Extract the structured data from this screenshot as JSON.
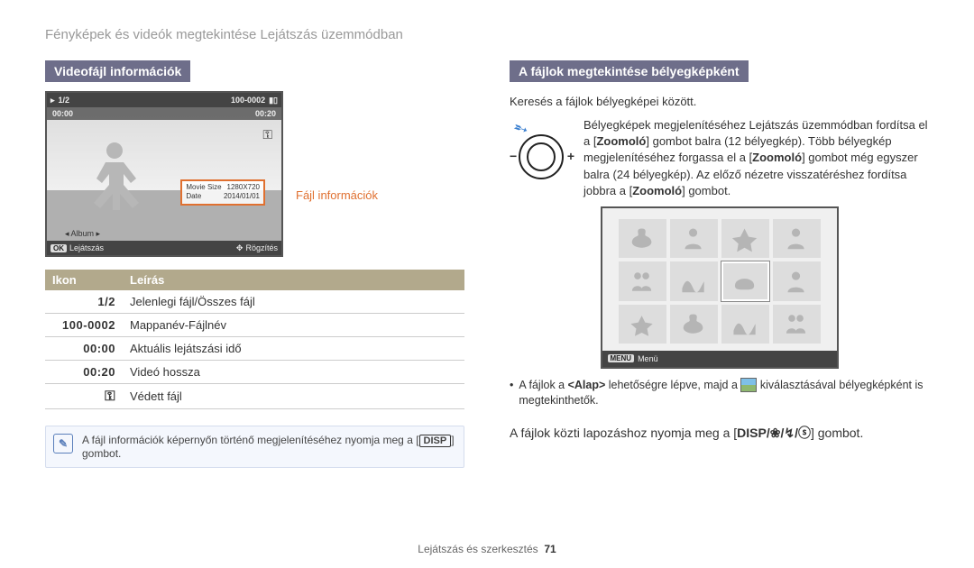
{
  "page_title": "Fényképek és videók megtekintése Lejátszás üzemmódban",
  "footer": {
    "section": "Lejátszás és szerkesztés",
    "page": "71"
  },
  "left": {
    "header": "Videofájl információk",
    "callout": "Fájl információk",
    "shot": {
      "topbar": {
        "counter": "1/2",
        "folder": "100-0002"
      },
      "times": {
        "current": "00:00",
        "total": "00:20"
      },
      "infobox": {
        "row1_label": "Movie Size",
        "row1_val": "1280X720",
        "row2_label": "Date",
        "row2_val": "2014/01/01"
      },
      "album_label": "Album",
      "botbar": {
        "ok": "OK",
        "play": "Lejátszás",
        "rec": "Rögzítés"
      }
    },
    "table": {
      "col1": "Ikon",
      "col2": "Leírás",
      "rows": [
        {
          "icon": "1/2",
          "desc": "Jelenlegi fájl/Összes fájl"
        },
        {
          "icon": "100-0002",
          "desc": "Mappanév-Fájlnév"
        },
        {
          "icon": "00:00",
          "desc": "Aktuális lejátszási idő"
        },
        {
          "icon": "00:20",
          "desc": "Videó hossza"
        },
        {
          "icon": "⚿",
          "desc": "Védett fájl"
        }
      ]
    },
    "note": {
      "text1": "A fájl információk képernyőn történő megjelenítéséhez nyomja meg a ",
      "badge": "DISP",
      "text2": " gombot."
    }
  },
  "right": {
    "header": "A fájlok megtekintése bélyegképként",
    "desc": "Keresés a fájlok bélyegképei között.",
    "zoom_text_pre": "Bélyegképek megjelenítéséhez Lejátszás üzemmódban fordítsa el a [",
    "zoom_b1": "Zoomoló",
    "zoom_text_mid1": "] gombot balra (12 bélyegkép). Több bélyegkép megjelenítéséhez forgassa el a [",
    "zoom_b2": "Zoomoló",
    "zoom_text_mid2": "] gombot még egyszer balra (24 bélyegkép). Az előző nézetre visszatéréshez fordítsa jobbra a [",
    "zoom_b3": "Zoomoló",
    "zoom_text_end": "] gombot.",
    "thumb_bot": {
      "menu": "MENU",
      "label": "Menü"
    },
    "bullet": {
      "pre": "A fájlok a ",
      "bold": "<Alap>",
      "mid": " lehetőségre lépve, majd a ",
      "post": " kiválasztásával bélyegképként is megtekinthetők."
    },
    "nav": {
      "pre": "A fájlok közti lapozáshoz nyomja meg a [",
      "keys": "DISP/␣/␣/␣",
      "post": "] gombot."
    }
  }
}
